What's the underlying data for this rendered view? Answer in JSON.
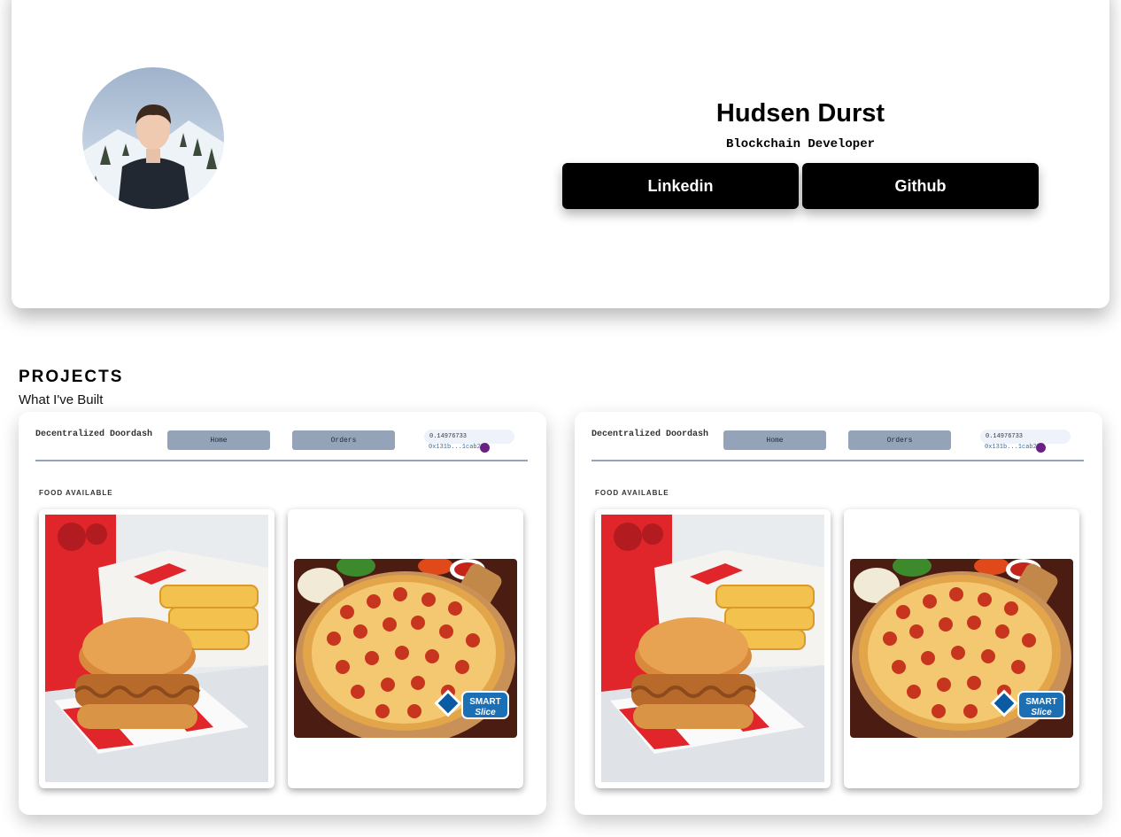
{
  "profile": {
    "name": "Hudsen Durst",
    "role": "Blockchain Developer",
    "avatar_icon": "profile-photo",
    "links": [
      {
        "label": "Linkedin"
      },
      {
        "label": "Github"
      }
    ]
  },
  "projects_section": {
    "title": "PROJECTS",
    "subtitle": "What I've Built",
    "items": [
      {
        "app_title": "Decentralized Doordash",
        "nav": [
          "Home",
          "Orders"
        ],
        "wallet_balance": "0.14976733",
        "wallet_address": "0x131b...1cab27",
        "section_label": "FOOD AVAILABLE",
        "foods": [
          {
            "image": "chicken-sandwich-image"
          },
          {
            "image": "pepperoni-pizza-image"
          }
        ]
      },
      {
        "app_title": "Decentralized Doordash",
        "nav": [
          "Home",
          "Orders"
        ],
        "wallet_balance": "0.14976733",
        "wallet_address": "0x131b...1cab27",
        "section_label": "FOOD AVAILABLE",
        "foods": [
          {
            "image": "chicken-sandwich-image"
          },
          {
            "image": "pepperoni-pizza-image"
          }
        ]
      }
    ]
  },
  "pizza_logo_text": "SMART Slice",
  "colors": {
    "button_bg": "#000000",
    "nav_button_bg": "#94a3b8",
    "wallet_dot": "#6b2083"
  }
}
